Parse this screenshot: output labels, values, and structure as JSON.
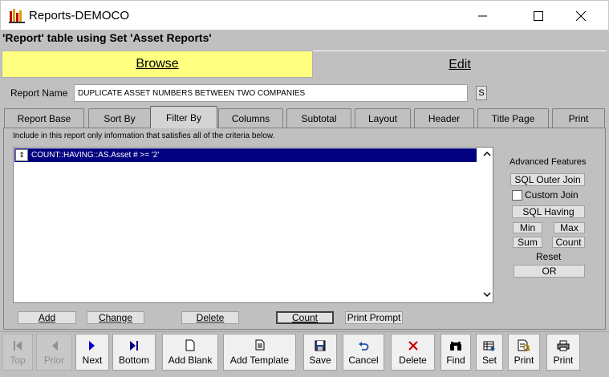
{
  "window": {
    "title": "Reports-DEMOCO"
  },
  "caption": "'Report' table using Set 'Asset Reports'",
  "modes": {
    "browse": "Browse",
    "edit": "Edit"
  },
  "report_name": {
    "label": "Report Name",
    "value": "DUPLICATE ASSET NUMBERS BETWEEN TWO COMPANIES",
    "lookup_button": "S"
  },
  "tabs": [
    "Report Base",
    "Sort By",
    "Filter By",
    "Columns",
    "Subtotal",
    "Layout",
    "Header",
    "Title Page",
    "Print"
  ],
  "active_tab": "Filter By",
  "filter": {
    "instruction": "Include in this report only information that satisfies all of the criteria below.",
    "criteria": [
      "COUNT::HAVING::AS.Asset # >= '2'"
    ]
  },
  "advanced": {
    "title": "Advanced Features",
    "sql_outer_join": "SQL Outer Join",
    "custom_join": "Custom Join",
    "sql_having": "SQL Having",
    "min": "Min",
    "max": "Max",
    "sum": "Sum",
    "count": "Count",
    "reset": "Reset",
    "or": "OR"
  },
  "actions": {
    "add": "Add",
    "change": "Change",
    "delete": "Delete",
    "count": "Count",
    "print_prompt": "Print Prompt"
  },
  "toolbar": {
    "top": "Top",
    "prior": "Prior",
    "next": "Next",
    "bottom": "Bottom",
    "add_blank": "Add Blank",
    "add_template": "Add Template",
    "save": "Save",
    "cancel": "Cancel",
    "delete": "Delete",
    "find": "Find",
    "set": "Set",
    "print_preview": "Print",
    "print": "Print"
  },
  "colors": {
    "browse_bg": "#ffff80",
    "selection": "#000080",
    "delete_icon": "#cc0000",
    "next_icon": "#0000cc"
  }
}
